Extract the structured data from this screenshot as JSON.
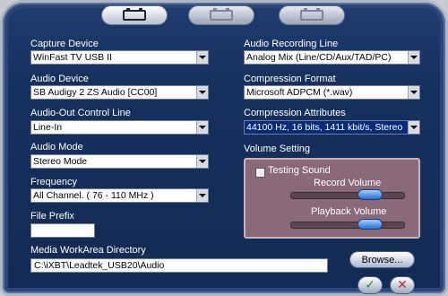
{
  "tabs": [
    {
      "icon": "capture-device-icon",
      "active": true
    },
    {
      "icon": "video-settings-icon",
      "active": false
    },
    {
      "icon": "tv-settings-icon",
      "active": false
    }
  ],
  "left": {
    "capture_device": {
      "label": "Capture Device",
      "value": "WinFast TV USB II"
    },
    "audio_device": {
      "label": "Audio Device",
      "value": "SB Audigy 2 ZS Audio [CC00]"
    },
    "audio_out_line": {
      "label": "Audio-Out Control Line",
      "value": "Line-In"
    },
    "audio_mode": {
      "label": "Audio Mode",
      "value": "Stereo Mode"
    },
    "frequency": {
      "label": "Frequency",
      "value": "All Channel. (  76 - 110 MHz  )"
    },
    "file_prefix": {
      "label": "File Prefix",
      "value": ""
    },
    "work_area": {
      "label": "Media WorkArea Directory",
      "value": "C:\\iXBT\\Leadtek_USB20\\Audio"
    }
  },
  "right": {
    "recording_line": {
      "label": "Audio Recording Line",
      "value": "Analog Mix (Line/CD/Aux/TAD/PC)"
    },
    "compression_format": {
      "label": "Compression Format",
      "value": "Microsoft ADPCM (*.wav)"
    },
    "compression_attributes": {
      "label": "Compression Attributes",
      "value": "44100 Hz, 16 bits, 1411 kbit/s, Stereo"
    },
    "volume": {
      "label": "Volume Setting",
      "testing_sound": "Testing Sound",
      "testing_checked": false,
      "record_label": "Record Volume",
      "record_level": 0.75,
      "playback_label": "Playback Volume",
      "playback_level": 0.75
    }
  },
  "buttons": {
    "browse": "Browse...",
    "ok_symbol": "✓",
    "cancel_symbol": "✕"
  },
  "colors": {
    "background": "#16305d",
    "panel": "#8a6a78",
    "highlight": "#0a2a7a",
    "ok": "#2e8b2e",
    "cancel": "#c0262c"
  }
}
